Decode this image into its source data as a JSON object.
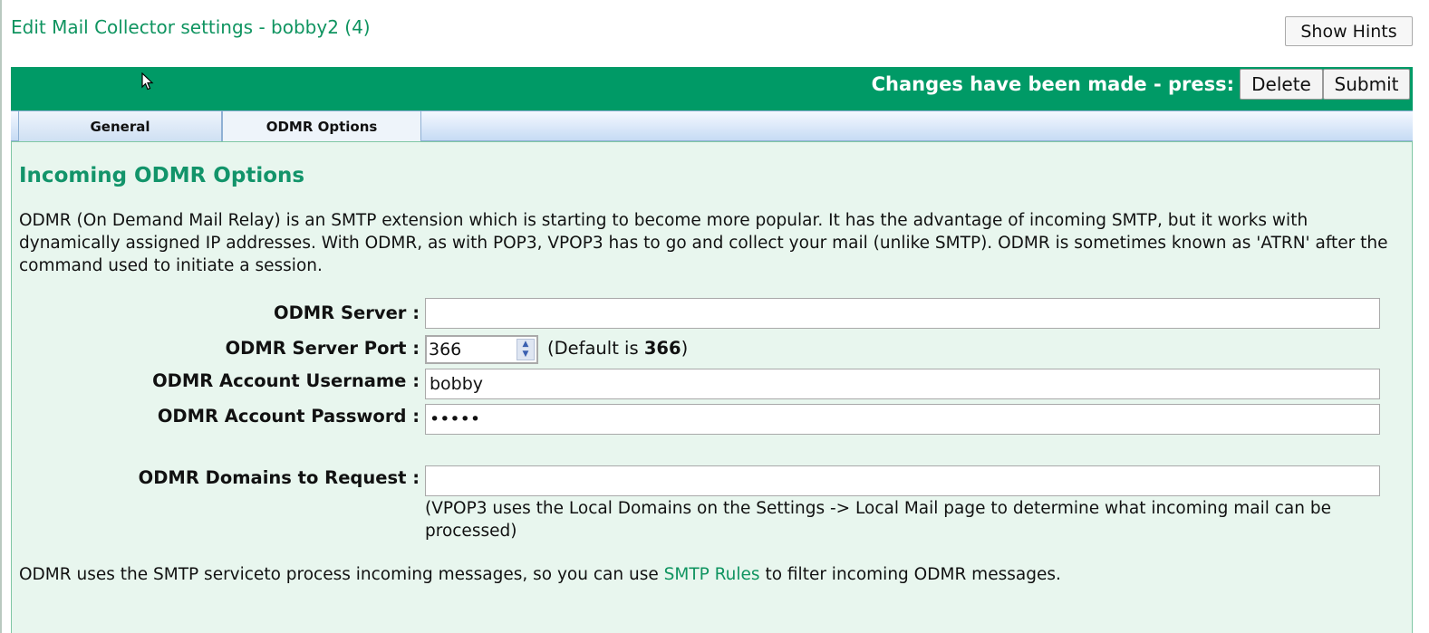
{
  "header": {
    "title": "Edit Mail Collector settings - bobby2 (4)",
    "show_hints_label": "Show Hints"
  },
  "action_bar": {
    "changes_text": "Changes have been made - press:",
    "delete_label": "Delete",
    "submit_label": "Submit"
  },
  "tabs": [
    {
      "label": "General",
      "active": false
    },
    {
      "label": "ODMR Options",
      "active": true
    }
  ],
  "section": {
    "title": "Incoming ODMR Options",
    "description": "ODMR (On Demand Mail Relay) is an SMTP extension which is starting to become more popular. It has the advantage of incoming SMTP, but it works with dynamically assigned IP addresses. With ODMR, as with POP3, VPOP3 has to go and collect your mail (unlike SMTP). ODMR is sometimes known as 'ATRN' after the command used to initiate a session."
  },
  "form": {
    "server": {
      "label": "ODMR Server :",
      "value": ""
    },
    "port": {
      "label": "ODMR Server Port :",
      "value": "366",
      "hint_prefix": "(Default is ",
      "hint_default": "366",
      "hint_suffix": ")"
    },
    "username": {
      "label": "ODMR Account Username :",
      "value": "bobby"
    },
    "password": {
      "label": "ODMR Account Password :",
      "value": "•••••"
    },
    "domains": {
      "label": "ODMR Domains to Request :",
      "value": "",
      "note": "(VPOP3 uses the Local Domains on the Settings -> Local Mail page to determine what incoming mail can be processed)"
    }
  },
  "footer": {
    "before_link": "ODMR uses the SMTP serviceto process incoming messages, so you can use ",
    "link_text": "SMTP Rules",
    "after_link": " to filter incoming ODMR messages."
  },
  "colors": {
    "accent_green": "#009a66",
    "title_green": "#0f9460",
    "panel_bg": "#e8f6ee"
  },
  "icons": {
    "cursor": "mouse-pointer-icon",
    "spinner_up": "chevron-up-icon",
    "spinner_down": "chevron-down-icon"
  }
}
